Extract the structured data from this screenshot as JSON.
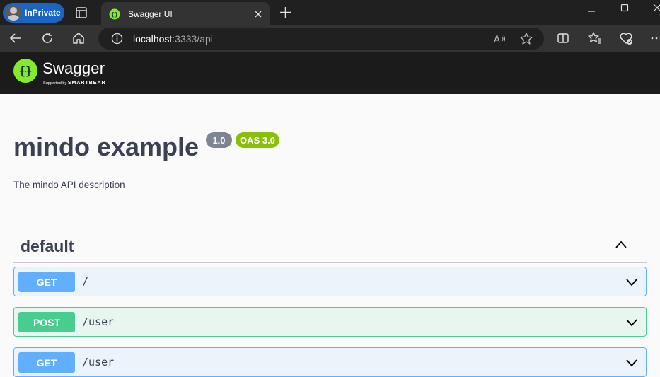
{
  "browser": {
    "inprivate_label": "InPrivate",
    "tab_title": "Swagger UI",
    "url_host": "localhost",
    "url_rest": ":3333/api",
    "colors": {
      "tabbar": "#202020",
      "toolbar": "#333333",
      "inprivate": "#1a64c2"
    }
  },
  "swagger": {
    "brand": "Swagger",
    "supported_by": "Supported by",
    "smartbear": "SMARTBEAR",
    "logo_color": "#85ea2d"
  },
  "info": {
    "title": "mindo example",
    "version": "1.0",
    "oas": "OAS 3.0",
    "description": "The mindo API description"
  },
  "tag": {
    "name": "default"
  },
  "operations": [
    {
      "method": "GET",
      "path": "/"
    },
    {
      "method": "POST",
      "path": "/user"
    },
    {
      "method": "GET",
      "path": "/user"
    }
  ]
}
